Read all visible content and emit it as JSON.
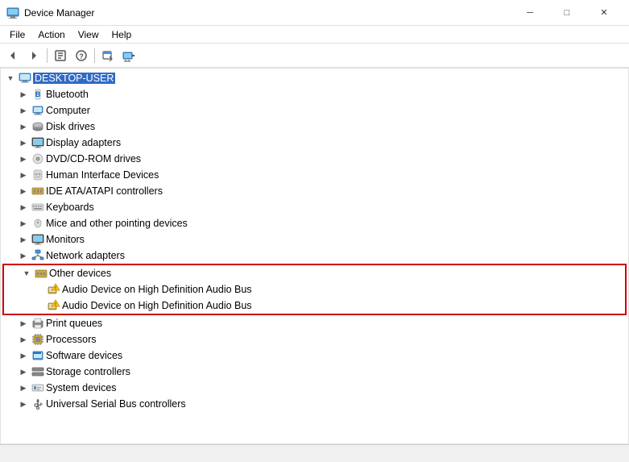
{
  "titleBar": {
    "title": "Device Manager",
    "icon": "💻",
    "minimizeLabel": "─",
    "maximizeLabel": "□",
    "closeLabel": "✕"
  },
  "menuBar": {
    "items": [
      {
        "label": "File"
      },
      {
        "label": "Action"
      },
      {
        "label": "View"
      },
      {
        "label": "Help"
      }
    ]
  },
  "toolbar": {
    "buttons": [
      {
        "name": "back",
        "icon": "←"
      },
      {
        "name": "forward",
        "icon": "→"
      },
      {
        "name": "properties",
        "icon": "📋"
      },
      {
        "name": "help",
        "icon": "?"
      },
      {
        "name": "update",
        "icon": "🔄"
      },
      {
        "name": "monitor",
        "icon": "🖥"
      }
    ]
  },
  "tree": {
    "rootLabel": "DESKTOP-USER",
    "items": [
      {
        "label": "Bluetooth",
        "indent": 1,
        "toggle": "▶",
        "icon": "bluetooth"
      },
      {
        "label": "Computer",
        "indent": 1,
        "toggle": "▶",
        "icon": "computer"
      },
      {
        "label": "Disk drives",
        "indent": 1,
        "toggle": "▶",
        "icon": "disk"
      },
      {
        "label": "Display adapters",
        "indent": 1,
        "toggle": "▶",
        "icon": "display"
      },
      {
        "label": "DVD/CD-ROM drives",
        "indent": 1,
        "toggle": "▶",
        "icon": "dvd"
      },
      {
        "label": "Human Interface Devices",
        "indent": 1,
        "toggle": "▶",
        "icon": "hid"
      },
      {
        "label": "IDE ATA/ATAPI controllers",
        "indent": 1,
        "toggle": "▶",
        "icon": "ide"
      },
      {
        "label": "Keyboards",
        "indent": 1,
        "toggle": "▶",
        "icon": "keyboard"
      },
      {
        "label": "Mice and other pointing devices",
        "indent": 1,
        "toggle": "▶",
        "icon": "mouse"
      },
      {
        "label": "Monitors",
        "indent": 1,
        "toggle": "▶",
        "icon": "monitor"
      },
      {
        "label": "Network adapters",
        "indent": 1,
        "toggle": "▶",
        "icon": "network"
      },
      {
        "label": "Other devices",
        "indent": 1,
        "toggle": "▼",
        "icon": "other",
        "expanded": true,
        "highlight": true
      },
      {
        "label": "Audio Device on High Definition Audio Bus",
        "indent": 2,
        "toggle": "",
        "icon": "warning-device",
        "highlight": true
      },
      {
        "label": "Audio Device on High Definition Audio Bus",
        "indent": 2,
        "toggle": "",
        "icon": "warning-device",
        "highlight": true
      },
      {
        "label": "Print queues",
        "indent": 1,
        "toggle": "▶",
        "icon": "print"
      },
      {
        "label": "Processors",
        "indent": 1,
        "toggle": "▶",
        "icon": "processor"
      },
      {
        "label": "Software devices",
        "indent": 1,
        "toggle": "▶",
        "icon": "software"
      },
      {
        "label": "Storage controllers",
        "indent": 1,
        "toggle": "▶",
        "icon": "storage"
      },
      {
        "label": "System devices",
        "indent": 1,
        "toggle": "▶",
        "icon": "system"
      },
      {
        "label": "Universal Serial Bus controllers",
        "indent": 1,
        "toggle": "▶",
        "icon": "usb"
      }
    ]
  },
  "statusBar": {
    "text": ""
  }
}
